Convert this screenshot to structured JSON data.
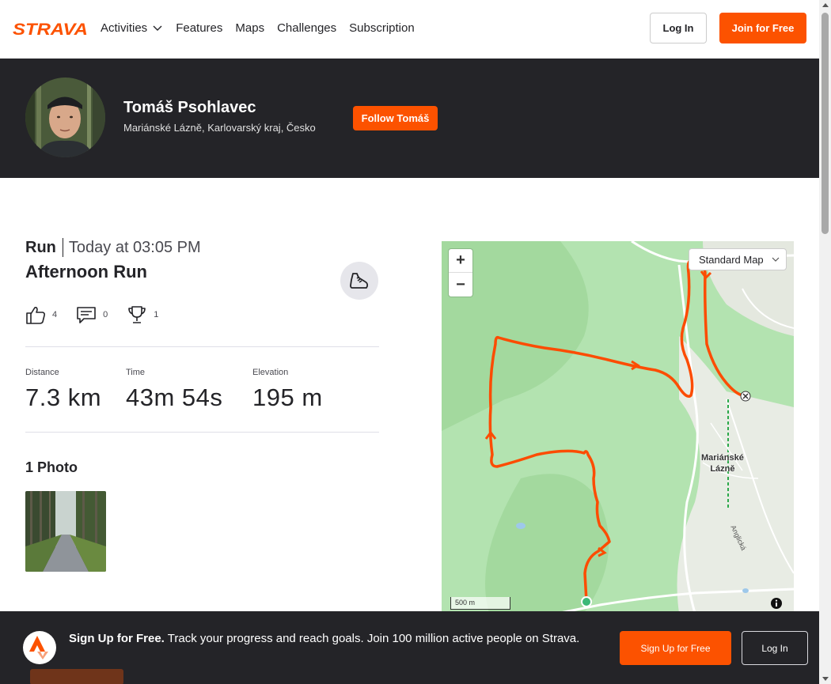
{
  "nav": {
    "logo_text": "STRAVA",
    "items": [
      {
        "label": "Activities",
        "has_dropdown": true
      },
      {
        "label": "Features"
      },
      {
        "label": "Maps"
      },
      {
        "label": "Challenges"
      },
      {
        "label": "Subscription"
      }
    ],
    "login_label": "Log In",
    "join_label": "Join for Free",
    "brand_color": "#fc5200"
  },
  "athlete": {
    "name": "Tomáš Psohlavec",
    "location": "Mariánské Lázně, Karlovarský kraj, Česko",
    "follow_label": "Follow Tomáš"
  },
  "activity": {
    "type": "Run",
    "time": "Today at 03:05 PM",
    "title": "Afternoon Run",
    "gear_icon": "shoe-icon",
    "kudos": "4",
    "comments": "0",
    "achievements": "1",
    "stats": [
      {
        "label": "Distance",
        "value": "7.3 km"
      },
      {
        "label": "Time",
        "value": "43m 54s"
      },
      {
        "label": "Elevation",
        "value": "195 m"
      }
    ],
    "photos_title": "1 Photo"
  },
  "map": {
    "style_label": "Standard Map",
    "zoom_in": "+",
    "zoom_out": "−",
    "scale_label": "500 m",
    "place_label_line1": "Mariánské",
    "place_label_line2": "Lázně",
    "street_label": "Anglická",
    "route_color": "#fc4c02"
  },
  "banner": {
    "headline": "Sign Up for Free.",
    "body": "Track your progress and reach goals. Join 100 million active people on Strava.",
    "join_label": "Sign Up for Free",
    "login_label": "Log In"
  }
}
